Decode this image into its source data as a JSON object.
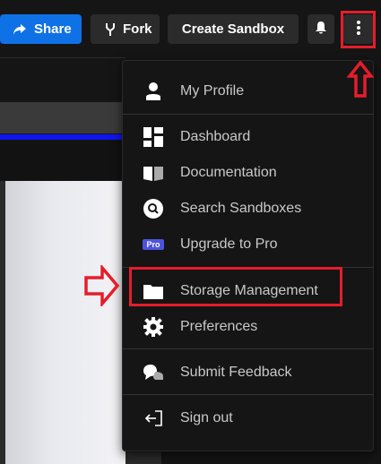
{
  "toolbar": {
    "share_label": "Share",
    "fork_label": "Fork",
    "create_label": "Create Sandbox",
    "share_color": "#0f71e6"
  },
  "menu": {
    "profile": "My Profile",
    "dashboard": "Dashboard",
    "documentation": "Documentation",
    "search": "Search Sandboxes",
    "upgrade": "Upgrade to Pro",
    "pro_badge": "Pro",
    "storage": "Storage Management",
    "preferences": "Preferences",
    "feedback": "Submit Feedback",
    "signout": "Sign out"
  },
  "highlight_color": "#e51d2b"
}
